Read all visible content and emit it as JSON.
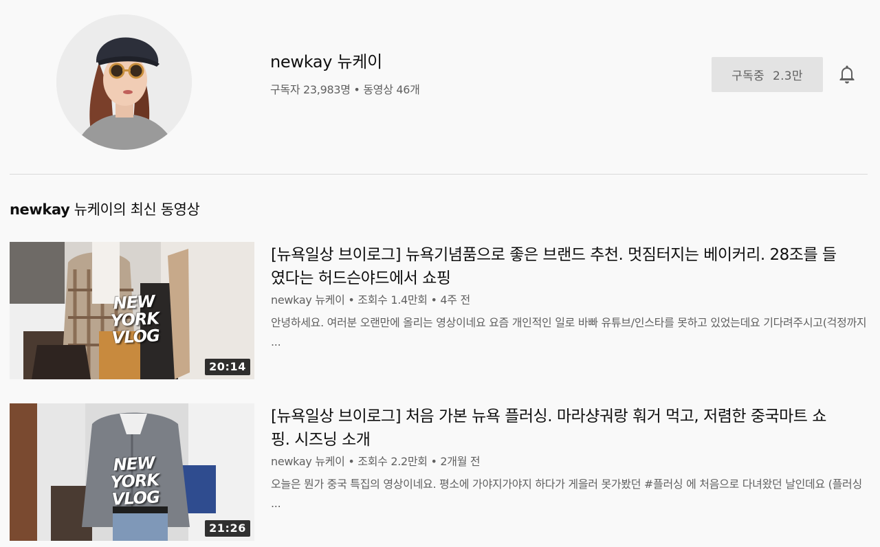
{
  "channel": {
    "name": "newkay 뉴케이",
    "meta": "구독자 23,983명 • 동영상 46개",
    "subscribe_label": "구독중",
    "subscribe_count": "2.3만"
  },
  "section": {
    "title_bold": "newkay",
    "title_rest": " 뉴케이의 최신 동영상"
  },
  "videos": [
    {
      "title": "[뉴욕일상 브이로그] 뉴욕기념품으로 좋은 브랜드 추천. 멋짐터지는 베이커리. 28조를 들였다는 허드슨야드에서 쇼핑",
      "meta": "newkay 뉴케이 • 조회수 1.4만회 • 4주 전",
      "description": "안녕하세요. 여러분 오랜만에 올리는 영상이네요 요즘 개인적인 일로 바빠 유튜브/인스타를 못하고 있었는데요 기다려주시고(걱정까지 ...",
      "duration": "20:14",
      "thumb_text_1": "NEW YORK",
      "thumb_text_2": "VLOG"
    },
    {
      "title": "[뉴욕일상 브이로그] 처음 가본 뉴욕 플러싱. 마라샹궈랑 훠거 먹고, 저렴한 중국마트 쇼핑. 시즈닝 소개",
      "meta": "newkay 뉴케이 • 조회수 2.2만회 • 2개월 전",
      "description": "오늘은 뭔가 중국 특집의 영상이네요. 평소에 가야지가야지 하다가 게을러 못가봤던 #플러싱 에 처음으로 다녀왔던 날인데요 (플러싱 ...",
      "duration": "21:26",
      "thumb_text_1": "NEW YORK",
      "thumb_text_2": "VLOG"
    }
  ],
  "colors": {
    "background": "#f9f9f9",
    "subscribe_bg": "#e3e3e3",
    "secondary_text": "#606060"
  },
  "icons": {
    "bell": "bell-icon"
  }
}
